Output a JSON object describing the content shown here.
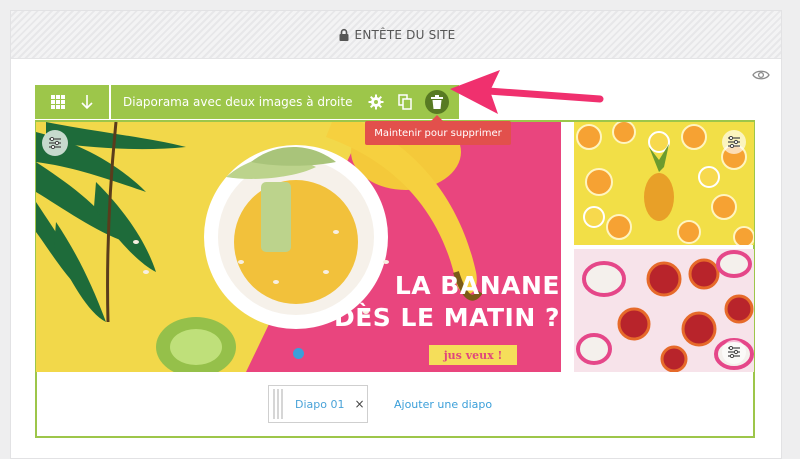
{
  "header": {
    "label": "ENTÊTE DU SITE",
    "icon": "lock-icon"
  },
  "toolbar": {
    "title": "Diaporama avec deux images à droite",
    "icons": [
      "grid-icon",
      "arrow-down-icon",
      "gear-icon",
      "duplicate-icon",
      "trash-icon"
    ],
    "accent": "#9dc64a",
    "trash_bg": "#587a23"
  },
  "tooltip": {
    "text": "Maintenir pour supprimer",
    "color": "#e2504c"
  },
  "annotation_arrow_color": "#f0306e",
  "slide": {
    "title_line1": "LA BANANE",
    "title_line2": "DÈS LE MATIN ?",
    "cta": "jus veux !"
  },
  "tabs": {
    "items": [
      {
        "label": "Diapo 01",
        "close": "×"
      }
    ],
    "add_label": "Ajouter une diapo"
  },
  "colors": {
    "link": "#3b9fd9",
    "pink_bg": "#e9457e",
    "yellow_bg": "#f4dc4f"
  }
}
